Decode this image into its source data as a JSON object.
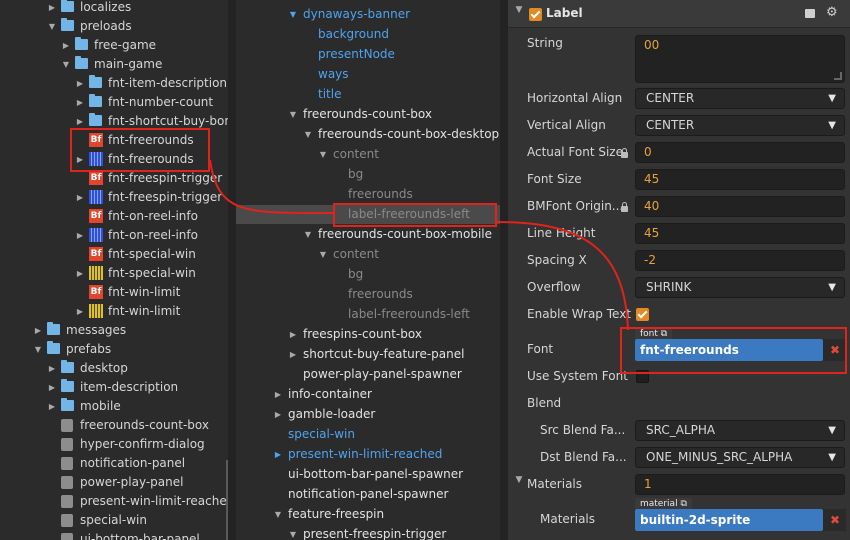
{
  "assets": {
    "items": [
      {
        "label": "localizes",
        "depth": 3,
        "type": "folder",
        "arrow": "right"
      },
      {
        "label": "preloads",
        "depth": 3,
        "type": "folder",
        "arrow": "down"
      },
      {
        "label": "free-game",
        "depth": 4,
        "type": "folder",
        "arrow": "right"
      },
      {
        "label": "main-game",
        "depth": 4,
        "type": "folder",
        "arrow": "down"
      },
      {
        "label": "fnt-item-description",
        "depth": 5,
        "type": "folder",
        "arrow": "right"
      },
      {
        "label": "fnt-number-count",
        "depth": 5,
        "type": "folder",
        "arrow": "right"
      },
      {
        "label": "fnt-shortcut-buy-bonus",
        "depth": 5,
        "type": "folder",
        "arrow": "right"
      },
      {
        "label": "fnt-freerounds",
        "depth": 5,
        "type": "bf",
        "arrow": ""
      },
      {
        "label": "fnt-freerounds",
        "depth": 5,
        "type": "fntimg",
        "arrow": "right"
      },
      {
        "label": "fnt-freespin-trigger",
        "depth": 5,
        "type": "bf",
        "arrow": ""
      },
      {
        "label": "fnt-freespin-trigger",
        "depth": 5,
        "type": "fntimg",
        "arrow": "right"
      },
      {
        "label": "fnt-on-reel-info",
        "depth": 5,
        "type": "bf",
        "arrow": ""
      },
      {
        "label": "fnt-on-reel-info",
        "depth": 5,
        "type": "fntimg",
        "arrow": "right"
      },
      {
        "label": "fnt-special-win",
        "depth": 5,
        "type": "bf",
        "arrow": ""
      },
      {
        "label": "fnt-special-win",
        "depth": 5,
        "type": "fntimg-yellow",
        "arrow": "right"
      },
      {
        "label": "fnt-win-limit",
        "depth": 5,
        "type": "bf",
        "arrow": ""
      },
      {
        "label": "fnt-win-limit",
        "depth": 5,
        "type": "fntimg-yellow",
        "arrow": "right"
      },
      {
        "label": "messages",
        "depth": 2,
        "type": "folder",
        "arrow": "right"
      },
      {
        "label": "prefabs",
        "depth": 2,
        "type": "folder",
        "arrow": "down"
      },
      {
        "label": "desktop",
        "depth": 3,
        "type": "folder",
        "arrow": "right"
      },
      {
        "label": "item-description",
        "depth": 3,
        "type": "folder",
        "arrow": "right"
      },
      {
        "label": "mobile",
        "depth": 3,
        "type": "folder",
        "arrow": "right"
      },
      {
        "label": "freerounds-count-box",
        "depth": 3,
        "type": "prefab",
        "arrow": ""
      },
      {
        "label": "hyper-confirm-dialog",
        "depth": 3,
        "type": "prefab",
        "arrow": ""
      },
      {
        "label": "notification-panel",
        "depth": 3,
        "type": "prefab",
        "arrow": ""
      },
      {
        "label": "power-play-panel",
        "depth": 3,
        "type": "prefab",
        "arrow": ""
      },
      {
        "label": "present-win-limit-reached",
        "depth": 3,
        "type": "prefab",
        "arrow": ""
      },
      {
        "label": "special-win",
        "depth": 3,
        "type": "prefab",
        "arrow": ""
      },
      {
        "label": "ui-bottom-bar-panel",
        "depth": 3,
        "type": "prefab",
        "arrow": ""
      }
    ]
  },
  "hierarchy": {
    "items": [
      {
        "label": "dynaways-banner",
        "depth": 1,
        "style": "blue",
        "arrow": "down"
      },
      {
        "label": "background",
        "depth": 2,
        "style": "blue",
        "arrow": ""
      },
      {
        "label": "presentNode",
        "depth": 2,
        "style": "blue",
        "arrow": ""
      },
      {
        "label": "ways",
        "depth": 2,
        "style": "blue",
        "arrow": ""
      },
      {
        "label": "title",
        "depth": 2,
        "style": "blue",
        "arrow": ""
      },
      {
        "label": "freerounds-count-box",
        "depth": 1,
        "style": "white",
        "arrow": "down"
      },
      {
        "label": "freerounds-count-box-desktop",
        "depth": 2,
        "style": "white",
        "arrow": "down"
      },
      {
        "label": "content",
        "depth": 3,
        "style": "dim",
        "arrow": "down"
      },
      {
        "label": "bg",
        "depth": 4,
        "style": "dim",
        "arrow": ""
      },
      {
        "label": "freerounds",
        "depth": 4,
        "style": "dim",
        "arrow": ""
      },
      {
        "label": "label-freerounds-left",
        "depth": 4,
        "style": "dim",
        "arrow": "",
        "selected": true
      },
      {
        "label": "freerounds-count-box-mobile",
        "depth": 2,
        "style": "white",
        "arrow": "down"
      },
      {
        "label": "content",
        "depth": 3,
        "style": "dim",
        "arrow": "down"
      },
      {
        "label": "bg",
        "depth": 4,
        "style": "dim",
        "arrow": ""
      },
      {
        "label": "freerounds",
        "depth": 4,
        "style": "dim",
        "arrow": ""
      },
      {
        "label": "label-freerounds-left",
        "depth": 4,
        "style": "dim",
        "arrow": ""
      },
      {
        "label": "freespins-count-box",
        "depth": 1,
        "style": "white",
        "arrow": "right"
      },
      {
        "label": "shortcut-buy-feature-panel",
        "depth": 1,
        "style": "white",
        "arrow": "right"
      },
      {
        "label": "power-play-panel-spawner",
        "depth": 1,
        "style": "white",
        "arrow": ""
      },
      {
        "label": "info-container",
        "depth": 0,
        "style": "white",
        "arrow": "right"
      },
      {
        "label": "gamble-loader",
        "depth": 0,
        "style": "white",
        "arrow": "right"
      },
      {
        "label": "special-win",
        "depth": 0,
        "style": "blue",
        "arrow": ""
      },
      {
        "label": "present-win-limit-reached",
        "depth": 0,
        "style": "blue",
        "arrow": "right"
      },
      {
        "label": "ui-bottom-bar-panel-spawner",
        "depth": 0,
        "style": "white",
        "arrow": ""
      },
      {
        "label": "notification-panel-spawner",
        "depth": 0,
        "style": "white",
        "arrow": ""
      },
      {
        "label": "feature-freespin",
        "depth": 0,
        "style": "white",
        "arrow": "down"
      },
      {
        "label": "present-freespin-trigger",
        "depth": 1,
        "style": "white",
        "arrow": "down"
      }
    ]
  },
  "inspector": {
    "component_title": "Label",
    "properties": {
      "string_label": "String",
      "string_value": "00",
      "horizontal_align_label": "Horizontal Align",
      "horizontal_align_value": "CENTER",
      "vertical_align_label": "Vertical Align",
      "vertical_align_value": "CENTER",
      "actual_font_size_label": "Actual Font Size",
      "actual_font_size_value": "0",
      "font_size_label": "Font Size",
      "font_size_value": "45",
      "bmfont_origin_label": "BMFont Origin...",
      "bmfont_origin_value": "40",
      "line_height_label": "Line Height",
      "line_height_value": "45",
      "spacing_x_label": "Spacing X",
      "spacing_x_value": "-2",
      "overflow_label": "Overflow",
      "overflow_value": "SHRINK",
      "enable_wrap_label": "Enable Wrap Text",
      "font_label": "Font",
      "font_tag": "font",
      "font_value": "fnt-freerounds",
      "use_system_font_label": "Use System Font",
      "blend_label": "Blend",
      "src_blend_label": "Src Blend Fa...",
      "src_blend_value": "SRC_ALPHA",
      "dst_blend_label": "Dst Blend Fa...",
      "dst_blend_value": "ONE_MINUS_SRC_ALPHA",
      "materials_label": "Materials",
      "materials_count": "1",
      "materials_item_label": "Materials",
      "material_tag": "material",
      "material_value": "builtin-2d-sprite",
      "remove_symbol": "✖"
    }
  },
  "colors": {
    "annotation": "#e0231b",
    "accent": "#e28a23",
    "asset_ref": "#3b7ac0"
  }
}
